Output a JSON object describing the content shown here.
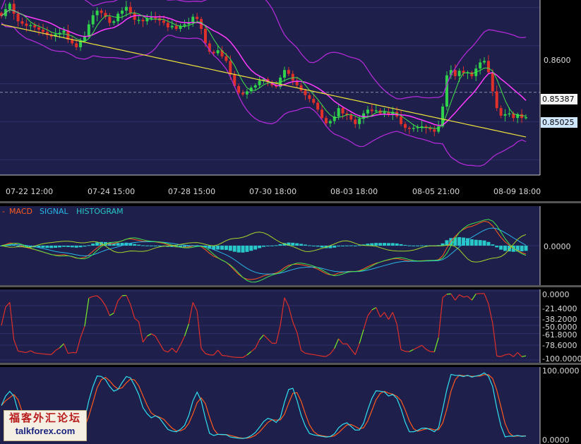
{
  "colors": {
    "panel_bg": "#1e1f4a",
    "grid": "#2e3068",
    "axis_text": "#d8d8d8",
    "candle_up": "#2fd24a",
    "candle_down": "#e0302a",
    "bollinger": "#b02ad6",
    "ma_fast": "#44e64a",
    "ma_slow": "#ff3cff",
    "ma_long": "#f1e43c",
    "macd": "#ff5a1e",
    "signal": "#29b6e8",
    "histogram": "#28c8c8",
    "rsi": "#e0302a",
    "rsi_up": "#7cf028",
    "stoch_k": "#ff5a1e",
    "stoch_d": "#30e0f0"
  },
  "chart_data": [
    {
      "type": "line",
      "name": "price",
      "x_ticks": [
        "07-22 12:00",
        "07-24 15:00",
        "07-28 15:00",
        "07-30 18:00",
        "08-03 18:00",
        "08-05 21:00",
        "08-09 18:00"
      ],
      "y_ticks": [
        "0.8600"
      ],
      "price_labels": [
        "0.85387",
        "0.85025"
      ],
      "ylim": [
        0.843,
        0.866
      ],
      "close": [
        0.8639,
        0.8648,
        0.8655,
        0.8642,
        0.8632,
        0.8629,
        0.8626,
        0.8627,
        0.8624,
        0.8621,
        0.8618,
        0.8614,
        0.8612,
        0.8615,
        0.8617,
        0.862,
        0.8608,
        0.8603,
        0.8598,
        0.8606,
        0.8612,
        0.8628,
        0.864,
        0.8646,
        0.8643,
        0.8638,
        0.863,
        0.8632,
        0.8642,
        0.8646,
        0.8651,
        0.8643,
        0.8634,
        0.8634,
        0.8632,
        0.8636,
        0.8637,
        0.8636,
        0.8633,
        0.863,
        0.8624,
        0.8626,
        0.8622,
        0.8626,
        0.8628,
        0.863,
        0.8638,
        0.8635,
        0.8622,
        0.8603,
        0.8592,
        0.859,
        0.8594,
        0.8586,
        0.858,
        0.8562,
        0.8547,
        0.8538,
        0.8536,
        0.854,
        0.8545,
        0.8548,
        0.8554,
        0.8556,
        0.8552,
        0.8548,
        0.8546,
        0.8558,
        0.8568,
        0.8563,
        0.8554,
        0.8548,
        0.8541,
        0.8535,
        0.853,
        0.8525,
        0.8516,
        0.8505,
        0.8498,
        0.8501,
        0.8507,
        0.8518,
        0.8511,
        0.8509,
        0.8503,
        0.8497,
        0.8504,
        0.8511,
        0.8516,
        0.8514,
        0.8515,
        0.8511,
        0.8513,
        0.851,
        0.8513,
        0.8507,
        0.8497,
        0.8492,
        0.8491,
        0.8492,
        0.8493,
        0.8494,
        0.8492,
        0.849,
        0.8487,
        0.8494,
        0.852,
        0.8561,
        0.8568,
        0.856,
        0.8567,
        0.8564,
        0.8565,
        0.856,
        0.857,
        0.8578,
        0.858,
        0.8565,
        0.854,
        0.8518,
        0.8508,
        0.851,
        0.8511,
        0.8505,
        0.851,
        0.8505,
        0.8506
      ],
      "series": [
        {
          "name": "",
          "values_ref": "bb_upper"
        },
        {
          "name": "",
          "values_ref": "bb_lower"
        },
        {
          "name": "",
          "values_ref": "ma_fast"
        },
        {
          "name": "",
          "values_ref": "ma_slow"
        },
        {
          "name": "",
          "values_ref": "ma_long"
        }
      ],
      "ma_long_range": [
        0.8628,
        0.848
      ]
    },
    {
      "type": "line",
      "name": "macd",
      "legend": [
        "MACD",
        "SIGNAL",
        "HISTOGRAM"
      ],
      "y_ticks": [
        "0.0000"
      ],
      "ylim": [
        -0.003,
        0.003
      ]
    },
    {
      "type": "line",
      "name": "rsi-like",
      "y_ticks": [
        "0.0000",
        "-21.4000",
        "-38.2000",
        "-50.0000",
        "-61.8000",
        "-78.6000",
        "-100.0000"
      ],
      "ylim": [
        -100,
        0
      ]
    },
    {
      "type": "line",
      "name": "stochastic",
      "y_ticks": [
        "100.0000",
        "0.0000"
      ],
      "ylim": [
        0,
        100
      ]
    }
  ],
  "logo": {
    "cn": "福客外汇论坛",
    "en": "talkforex.com"
  }
}
